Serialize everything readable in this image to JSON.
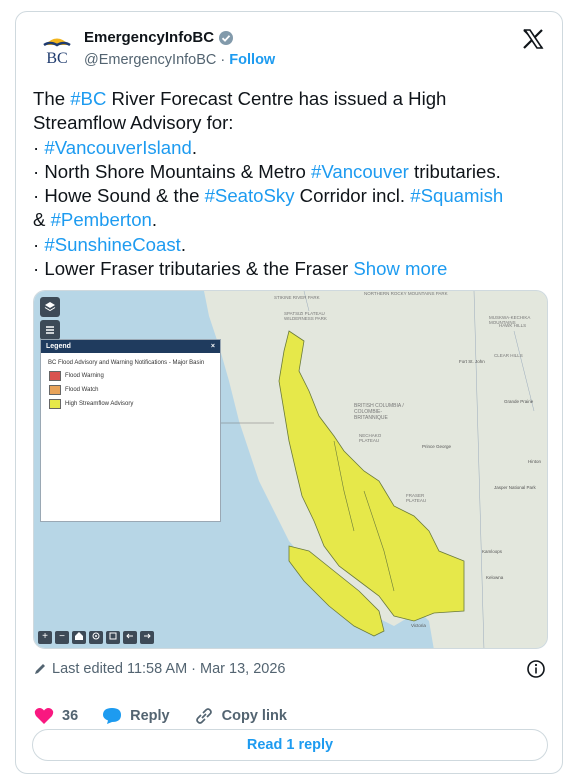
{
  "account": {
    "name": "EmergencyInfoBC",
    "handle": "@EmergencyInfoBC",
    "separator": "·",
    "follow_label": "Follow",
    "logo_text": "BC"
  },
  "tweet": {
    "lines": [
      [
        {
          "t": "The ",
          "tag": false
        },
        {
          "t": "#BC",
          "tag": true
        },
        {
          "t": " River Forecast Centre has issued a High",
          "tag": false
        }
      ],
      [
        {
          "t": "Streamflow Advisory for:",
          "tag": false
        }
      ],
      [
        {
          "t": "· ",
          "tag": false
        },
        {
          "t": "#VancouverIsland",
          "tag": true
        },
        {
          "t": ".",
          "tag": false
        }
      ],
      [
        {
          "t": "· North Shore Mountains & Metro ",
          "tag": false
        },
        {
          "t": "#Vancouver",
          "tag": true
        },
        {
          "t": " tributaries.",
          "tag": false
        }
      ],
      [
        {
          "t": "· Howe Sound & the ",
          "tag": false
        },
        {
          "t": "#SeatoSky",
          "tag": true
        },
        {
          "t": " Corridor incl. ",
          "tag": false
        },
        {
          "t": "#Squamish",
          "tag": true
        }
      ],
      [
        {
          "t": "& ",
          "tag": false
        },
        {
          "t": "#Pemberton",
          "tag": true
        },
        {
          "t": ".",
          "tag": false
        }
      ],
      [
        {
          "t": "· ",
          "tag": false
        },
        {
          "t": "#SunshineCoast",
          "tag": true
        },
        {
          "t": ".",
          "tag": false
        }
      ],
      [
        {
          "t": "· Lower Fraser tributaries & the Fraser ",
          "tag": false
        },
        {
          "t": "Show more",
          "tag": true
        }
      ]
    ]
  },
  "map": {
    "legend": {
      "header": "Legend",
      "close": "×",
      "title": "BC Flood Advisory and Warning Notifications - Major Basin",
      "items": [
        {
          "label": "Flood Warning",
          "color": "#d9534f"
        },
        {
          "label": "Flood Watch",
          "color": "#e8a35a"
        },
        {
          "label": "High Streamflow Advisory",
          "color": "#e6e84a"
        }
      ]
    },
    "place_labels": {
      "stikine": "STIKINE RIVER PARK",
      "spatsizi": "SPATSIZI PLATEAU WILDERNESS PARK",
      "northern_rocky": "NORTHERN ROCKY MOUNTAINS PARK",
      "muskwa": "MUSKWA-KECHIKA MOUNTAINS",
      "hawk_hills": "HAWK HILLS",
      "clear_hills": "CLEAR HILLS",
      "fort_st_john": "Fort St. John",
      "grande_prairie": "Grande Prairie",
      "bc": "BRITISH COLUMBIA / COLOMBIE-BRITANNIQUE",
      "nechako": "NECHAKO PLATEAU",
      "prince_george": "Prince George",
      "hinton": "Hinton",
      "jasper": "Jasper National Park",
      "fraser": "FRASER PLATEAU",
      "kamloops": "Kamloops",
      "kelowna": "Kelowna",
      "victoria": "Victoria",
      "bulltheater": "BULLHEAD MOUNTAIN"
    },
    "zoom_in": "+",
    "zoom_out": "−",
    "colors": {
      "advisory": "#e6e84a",
      "water": "#b7d6e6",
      "land": "#e3e7dd"
    }
  },
  "footer": {
    "edited": "Last edited 11:58 AM · Mar 13, 2026",
    "likes": "36",
    "reply_label": "Reply",
    "copy_link_label": "Copy link",
    "read_reply_label": "Read 1 reply"
  },
  "colors": {
    "accent": "#1d9bf0",
    "like": "#f91880"
  }
}
